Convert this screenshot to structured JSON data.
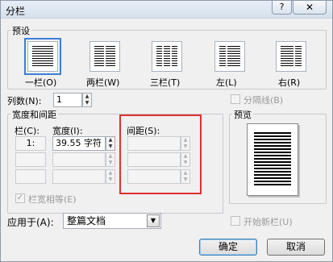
{
  "window": {
    "title": "分栏",
    "help_label": "?",
    "close_label": "✕"
  },
  "presets": {
    "group_label": "预设",
    "items": [
      {
        "label": "一栏(O)",
        "columns": 1,
        "selected": true
      },
      {
        "label": "两栏(W)",
        "columns": 2,
        "selected": false
      },
      {
        "label": "三栏(T)",
        "columns": 3,
        "selected": false
      },
      {
        "label": "左(L)",
        "columns": 2,
        "selected": false
      },
      {
        "label": "右(R)",
        "columns": 2,
        "selected": false
      }
    ]
  },
  "column_count": {
    "label": "列数(N):",
    "value": "1"
  },
  "separator": {
    "label": "分隔线(B)",
    "checked": false
  },
  "width_spacing": {
    "group_label": "宽度和间距",
    "col_header": "栏(C):",
    "width_header": "宽度(I):",
    "spacing_header": "间距(S):",
    "rows": [
      {
        "col": "1:",
        "width": "39.55 字符",
        "spacing": ""
      },
      {
        "col": "",
        "width": "",
        "spacing": ""
      },
      {
        "col": "",
        "width": "",
        "spacing": ""
      }
    ]
  },
  "equal_width": {
    "label": "栏宽相等(E)",
    "checked": true
  },
  "preview": {
    "group_label": "预览"
  },
  "apply_to": {
    "label": "应用于(A):",
    "value": "整篇文档",
    "arrow": "▼"
  },
  "new_column": {
    "label": "开始新栏(U)",
    "checked": false
  },
  "buttons": {
    "ok": "确定",
    "cancel": "取消"
  }
}
